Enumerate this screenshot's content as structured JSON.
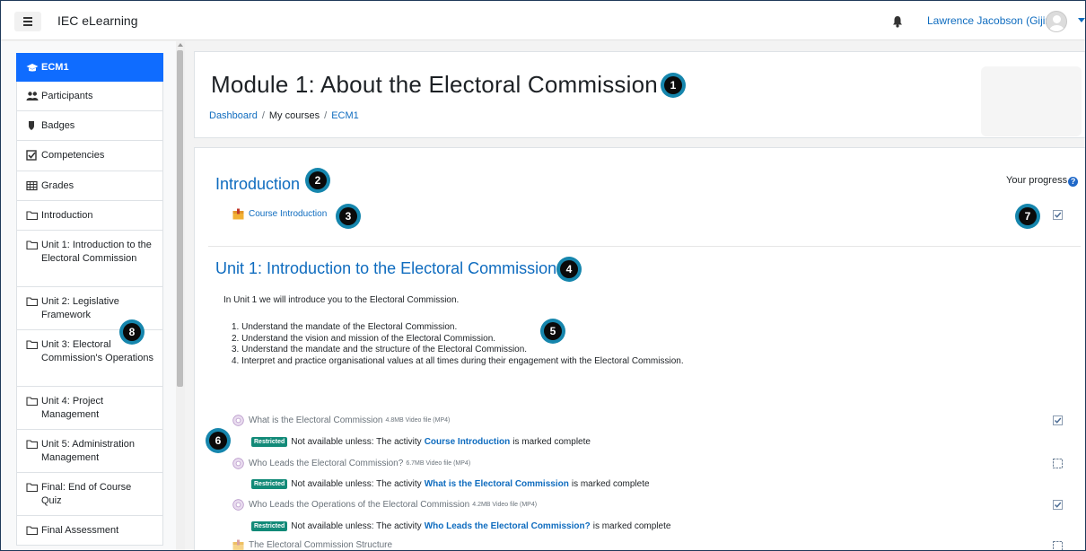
{
  "navbar": {
    "brand": "IEC eLearning",
    "user_name": "Lawrence Jacobson (Gijima)"
  },
  "sidebar": {
    "items": [
      {
        "label": "ECM1",
        "icon": "graduation-cap-icon",
        "active": true
      },
      {
        "label": "Participants",
        "icon": "users-icon"
      },
      {
        "label": "Badges",
        "icon": "shield-icon"
      },
      {
        "label": "Competencies",
        "icon": "checkbox-icon"
      },
      {
        "label": "Grades",
        "icon": "table-icon"
      },
      {
        "label": "Introduction",
        "icon": "folder-icon"
      },
      {
        "label": "Unit 1: Introduction to the Electoral Commission",
        "icon": "folder-icon"
      },
      {
        "label": "Unit 2: Legislative Framework",
        "icon": "folder-icon"
      },
      {
        "label": "Unit 3: Electoral Commission's Operations",
        "icon": "folder-icon"
      },
      {
        "label": "Unit 4: Project Management",
        "icon": "folder-icon"
      },
      {
        "label": "Unit 5: Administration Management",
        "icon": "folder-icon"
      },
      {
        "label": "Final: End of Course Quiz",
        "icon": "folder-icon"
      },
      {
        "label": "Final Assessment",
        "icon": "folder-icon"
      }
    ]
  },
  "header": {
    "title": "Module 1: About the Electoral Commission",
    "breadcrumb": [
      "Dashboard",
      "My courses",
      "ECM1"
    ]
  },
  "content": {
    "progress_label": "Your progress",
    "help_glyph": "?",
    "intro_section": {
      "title": "Introduction",
      "activity": {
        "label": "Course Introduction",
        "icon": "package-icon",
        "completed": true
      }
    },
    "unit1": {
      "title": "Unit 1: Introduction to the Electoral Commission",
      "summary": "In Unit 1 we will introduce you to the Electoral Commission.",
      "objectives": [
        "Understand the mandate of the Electoral Commission.",
        "Understand the vision and mission of the Electoral Commission.",
        "Understand the mandate and the structure of the Electoral Commission.",
        "Interpret and practice organisational values at all times during their engagement with the Electoral Commission."
      ],
      "activities": [
        {
          "label": "What is the Electoral Commission",
          "size": "4.8MB Video file (MP4)",
          "icon": "video-icon",
          "completed": true,
          "restriction": {
            "badge": "Restricted",
            "prefix": "Not available unless: The activity",
            "activity": "Course Introduction",
            "suffix": "is marked complete"
          }
        },
        {
          "label": "Who Leads the Electoral Commission?",
          "size": "6.7MB Video file (MP4)",
          "icon": "video-icon",
          "completed": false,
          "restriction": {
            "badge": "Restricted",
            "prefix": "Not available unless: The activity",
            "activity": "What is the Electoral Commission",
            "suffix": "is marked complete"
          }
        },
        {
          "label": "Who Leads the Operations of the Electoral Commission",
          "size": "4.2MB Video file (MP4)",
          "icon": "video-icon",
          "completed": true,
          "restriction": {
            "badge": "Restricted",
            "prefix": "Not available unless: The activity",
            "activity": "Who Leads the Electoral Commission?",
            "suffix": "is marked complete"
          }
        },
        {
          "label": "The Electoral Commission Structure",
          "icon": "package-icon",
          "completed": false
        }
      ]
    }
  },
  "markers": [
    "1",
    "2",
    "3",
    "4",
    "5",
    "6",
    "7",
    "8"
  ],
  "colors": {
    "primary": "#0f6cbf",
    "active_nav": "#0f6cff",
    "restricted_badge": "#128a78",
    "marker_ring": "#1686ad"
  }
}
